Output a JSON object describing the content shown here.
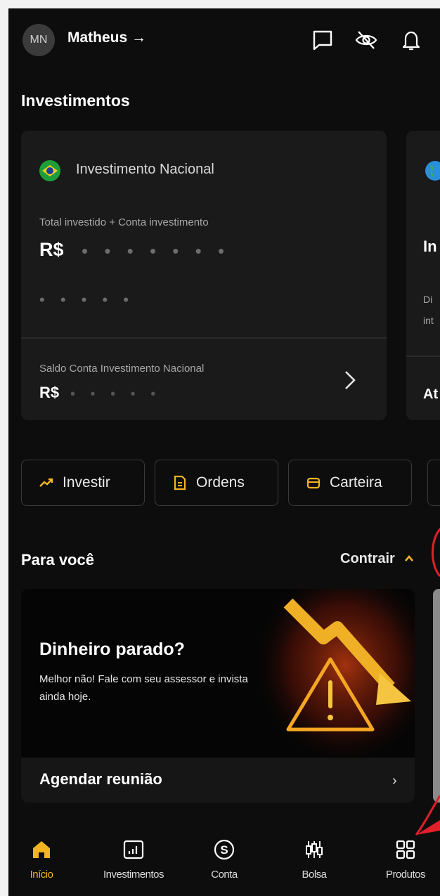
{
  "header": {
    "avatar_initials": "MN",
    "user_name": "Matheus →",
    "icons": [
      "chat-icon",
      "eye-off-icon",
      "bell-icon"
    ]
  },
  "investments": {
    "title": "Investimentos",
    "card": {
      "name": "Investimento Nacional",
      "total_label": "Total investido + Conta investimento",
      "currency": "R$",
      "total_masked": "• • • • • • •",
      "sub_masked": "• • • • •",
      "balance_label": "Saldo Conta Investimento Nacional",
      "balance_masked": "• • • • •"
    },
    "card2": {
      "title_fragment": "In",
      "text_fragment_1": "Di",
      "text_fragment_2": "int",
      "action_fragment": "At"
    }
  },
  "actions": [
    {
      "label": "Investir",
      "icon": "trend-up-icon"
    },
    {
      "label": "Ordens",
      "icon": "document-icon"
    },
    {
      "label": "Carteira",
      "icon": "wallet-icon"
    }
  ],
  "for_you": {
    "title": "Para você",
    "collapse_label": "Contrair",
    "promo": {
      "title": "Dinheiro parado?",
      "text": "Melhor não! Fale com seu assessor e invista ainda hoje.",
      "cta": "Agendar reunião"
    }
  },
  "nav": [
    {
      "label": "Início",
      "icon": "home-icon",
      "active": true
    },
    {
      "label": "Investimentos",
      "icon": "chart-icon",
      "active": false
    },
    {
      "label": "Conta",
      "icon": "dollar-coin-icon",
      "active": false
    },
    {
      "label": "Bolsa",
      "icon": "candlestick-icon",
      "active": false
    },
    {
      "label": "Produtos",
      "icon": "grid-icon",
      "active": false
    }
  ],
  "colors": {
    "accent": "#f2b520",
    "background": "#0d0d0d",
    "card": "#1a1a1a",
    "annotation": "#e0202a"
  }
}
